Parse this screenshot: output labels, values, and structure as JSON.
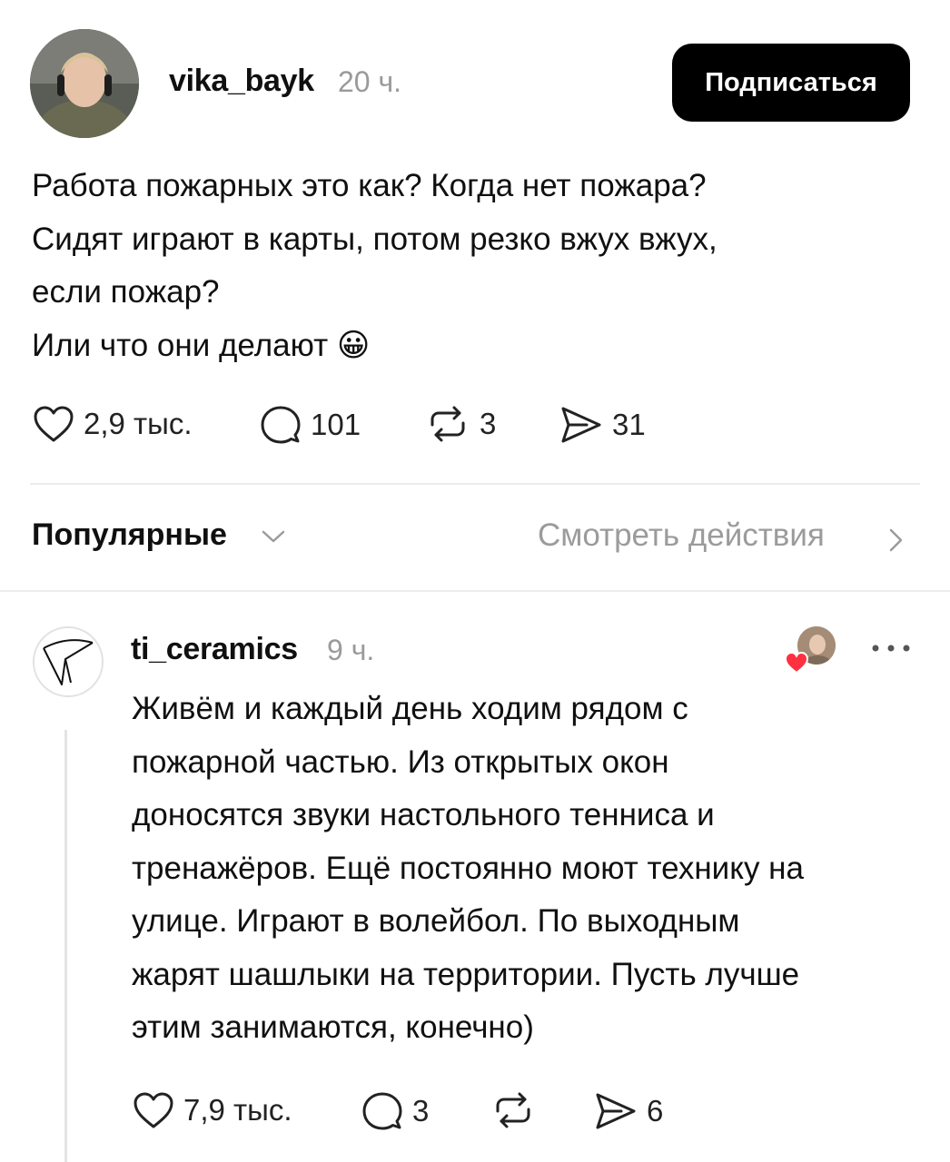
{
  "post": {
    "author": "vika_bayk",
    "time": "20 ч.",
    "follow_label": "Подписаться",
    "lines": [
      "Работа пожарных это как? Когда нет пожара?",
      "Сидят играют в карты, потом резко вжух вжух,",
      "если пожар?",
      "Или что они делают"
    ],
    "emoji": "😀",
    "likes": "2,9 тыс.",
    "comments": "101",
    "reposts": "3",
    "shares": "31"
  },
  "replies_bar": {
    "sort_label": "Популярные",
    "activity_label": "Смотреть действия"
  },
  "comment": {
    "author": "ti_ceramics",
    "time": "9 ч.",
    "lines": [
      "Живём и каждый день ходим рядом с",
      "пожарной частью. Из открытых окон",
      "доносятся звуки настольного тенниса и",
      "тренажёров. Ещё постоянно моют технику на",
      "улице. Играют в волейбол. По выходным",
      "жарят шашлыки на территории. Пусть лучше",
      "этим занимаются, конечно)"
    ],
    "likes": "7,9 тыс.",
    "comments": "3",
    "shares": "6"
  },
  "colors": {
    "accent": "#000000",
    "muted": "#9b9b9b",
    "heart": "#ff3040"
  }
}
